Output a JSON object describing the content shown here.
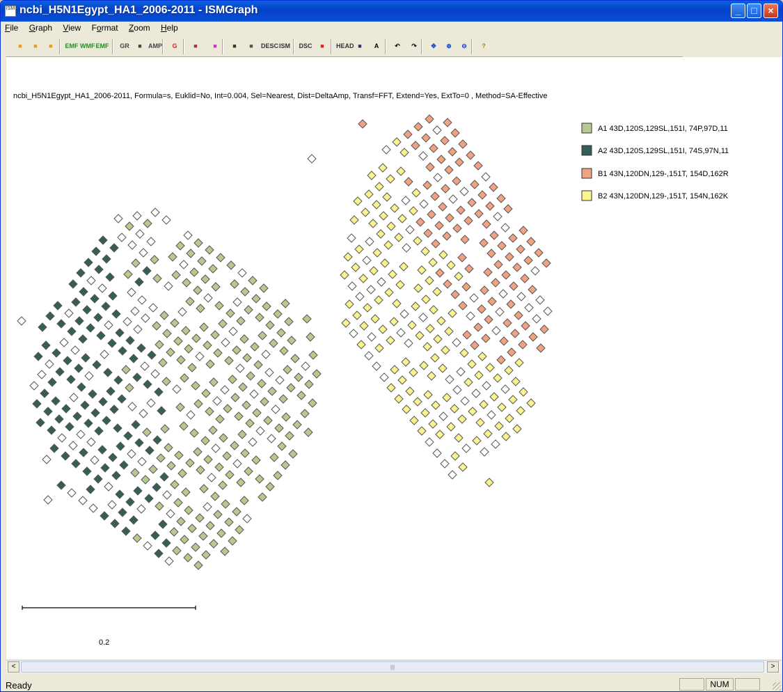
{
  "window": {
    "icon_text": "ISM",
    "title": "ncbi_H5N1Egypt_HA1_2006-2011 - ISMGraph",
    "min_icon": "minimize-icon",
    "max_icon": "maximize-icon",
    "close_icon": "close-icon"
  },
  "menu": [
    {
      "key": "F",
      "rest": "ile"
    },
    {
      "key": "G",
      "rest": "raph"
    },
    {
      "key": "V",
      "rest": "iew"
    },
    {
      "key": "o",
      "pre": "F",
      "rest": "rmat"
    },
    {
      "key": "Z",
      "rest": "oom"
    },
    {
      "key": "H",
      "rest": "elp"
    }
  ],
  "toolbar": {
    "buttons": [
      {
        "name": "open-icon",
        "label": ""
      },
      {
        "name": "open-graph-icon",
        "label": ""
      },
      {
        "name": "open-project-icon",
        "label": ""
      },
      {
        "name": "save-emf-icon",
        "label": "EMF"
      },
      {
        "name": "save-wmf-icon",
        "label": "WMF"
      },
      {
        "name": "save-emf2-icon",
        "label": "EMF"
      },
      {
        "name": "save-gr-icon",
        "label": "GR"
      },
      {
        "name": "save-icon",
        "label": ""
      },
      {
        "name": "save-amp-icon",
        "label": "AMP"
      },
      {
        "name": "g-icon",
        "label": "G"
      },
      {
        "name": "gene-icon",
        "label": ""
      },
      {
        "name": "color-grid-icon",
        "label": ""
      },
      {
        "name": "list-icon",
        "label": ""
      },
      {
        "name": "globe-icon",
        "label": ""
      },
      {
        "name": "desc-icon",
        "label": "DESC"
      },
      {
        "name": "ism-icon",
        "label": "ISM"
      },
      {
        "name": "dsc-icon",
        "label": "DSC"
      },
      {
        "name": "stop-icon",
        "label": ""
      },
      {
        "name": "head-icon",
        "label": "HEAD"
      },
      {
        "name": "table-icon",
        "label": ""
      },
      {
        "name": "font-icon",
        "label": "A"
      },
      {
        "name": "rotate-left-icon",
        "label": "↶"
      },
      {
        "name": "rotate-right-icon",
        "label": "↷"
      },
      {
        "name": "pan-icon",
        "label": "✥"
      },
      {
        "name": "zoom-in-icon",
        "label": "⊕"
      },
      {
        "name": "zoom-out-icon",
        "label": "⊖"
      },
      {
        "name": "help-icon",
        "label": "?"
      }
    ]
  },
  "info_line": "ncbi_H5N1Egypt_HA1_2006-2011, Formula=s, Euklid=No, Int=0.004, Sel=Nearest, Dist=DeltaAmp, Transf=FFT, Extend=Yes, ExtTo=0 , Method=SA-Effective",
  "colors": {
    "A1": "#b6c98e",
    "A2": "#365e58",
    "B1": "#f0a282",
    "B2": "#fbf58f",
    "unassigned": "#ffffff",
    "marker_edge": "#555555"
  },
  "chart_data": {
    "type": "scatter",
    "title": "",
    "xlabel": "",
    "ylabel": "",
    "legend_position": "top-right",
    "grid": false,
    "scalebar_label": "0.2",
    "series": [
      {
        "name": "A1 43D,120S,129SL,151I, 74P,97D,11",
        "color": "#b6c98e"
      },
      {
        "name": "A2 43D,120S,129SL,151I, 74S,97N,11",
        "color": "#365e58"
      },
      {
        "name": "B1 43N,120DN,129-,151T, 154D,162R",
        "color": "#f0a282"
      },
      {
        "name": "B2 43N,120DN,129-,151T, 154N,162K",
        "color": "#fbf58f"
      }
    ],
    "clusters": [
      {
        "name": "left",
        "series": [
          "A1",
          "A2"
        ]
      },
      {
        "name": "right",
        "series": [
          "B1",
          "B2"
        ]
      }
    ]
  },
  "scroll": {
    "left_arrow": "<",
    "right_arrow": ">",
    "grip": "|||"
  },
  "status": {
    "text": "Ready",
    "num": "NUM"
  }
}
